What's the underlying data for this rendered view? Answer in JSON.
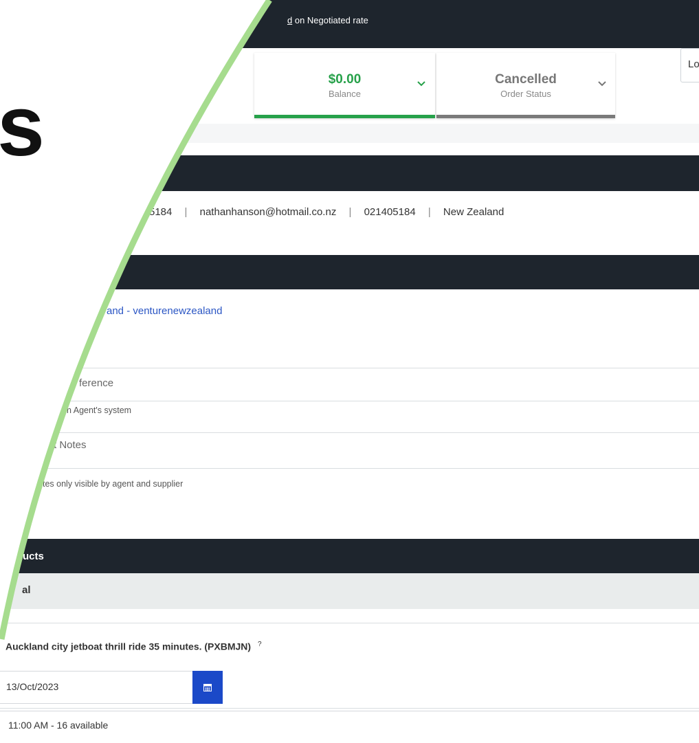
{
  "header": {
    "link_prefix": "",
    "link_underlined": "d",
    "link_suffix": " on Negotiated rate"
  },
  "balance_card": {
    "value": "$0.00",
    "label": "Balance",
    "accent": "#27a14a"
  },
  "status_card": {
    "value": "Cancelled",
    "label": "Order Status",
    "accent": "#7a7a7a"
  },
  "lang_button": {
    "label": "Lo"
  },
  "big_letter": "s",
  "contact": {
    "phone_partial": "5184",
    "sep1": "|",
    "email": "nathanhanson@hotmail.co.nz",
    "sep2": "|",
    "mobile": "021405184",
    "sep3": "|",
    "country": "New Zealand"
  },
  "agent": {
    "link": "and - venturenewzealand",
    "reference_label": "ference",
    "reference_hint": "n Agent's system",
    "notes_label": "t Notes",
    "notes_hint": "tes only visible by agent and supplier"
  },
  "products": {
    "section_title": "ucts",
    "subheader": "al",
    "item_name": "Auckland city jetboat thrill ride 35 minutes. (PXBMJN)",
    "help_mark": "?",
    "date_value": "13/Oct/2023",
    "time_slot": "11:00 AM - 16 available"
  },
  "icons": {
    "chevron": "chevron-down-icon",
    "calendar": "calendar-icon"
  },
  "colors": {
    "dark_bar": "#1e252d",
    "green_arc": "#a6dc8e",
    "link_blue": "#2b56c4",
    "calendar_btn": "#1b49c8"
  }
}
